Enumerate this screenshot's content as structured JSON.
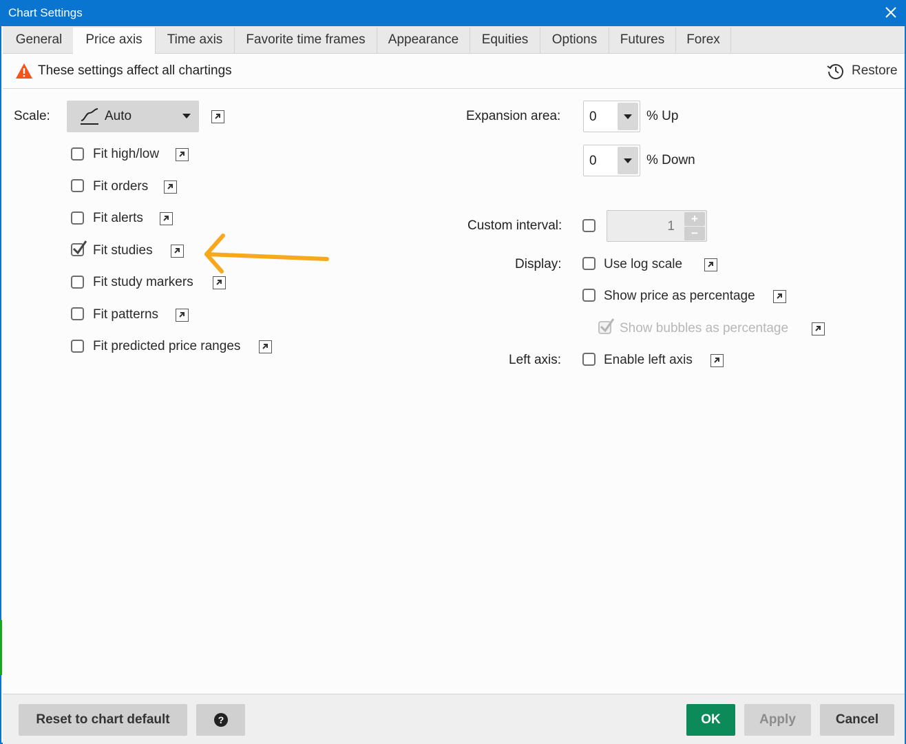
{
  "window": {
    "title": "Chart Settings"
  },
  "tabs": [
    {
      "label": "General"
    },
    {
      "label": "Price axis",
      "active": true
    },
    {
      "label": "Time axis"
    },
    {
      "label": "Favorite time frames"
    },
    {
      "label": "Appearance"
    },
    {
      "label": "Equities"
    },
    {
      "label": "Options"
    },
    {
      "label": "Futures"
    },
    {
      "label": "Forex"
    }
  ],
  "warning": {
    "text": "These settings affect all chartings",
    "icon": "warning-icon"
  },
  "restore": {
    "label": "Restore",
    "icon": "history-icon"
  },
  "scale": {
    "label": "Scale:",
    "value": "Auto"
  },
  "fit_options": [
    {
      "label": "Fit high/low",
      "checked": false
    },
    {
      "label": "Fit orders",
      "checked": false
    },
    {
      "label": "Fit alerts",
      "checked": false
    },
    {
      "label": "Fit studies",
      "checked": true
    },
    {
      "label": "Fit study markers",
      "checked": false
    },
    {
      "label": "Fit patterns",
      "checked": false
    },
    {
      "label": "Fit predicted price ranges",
      "checked": false
    }
  ],
  "expansion": {
    "label": "Expansion area:",
    "up_value": "0",
    "up_unit": "% Up",
    "down_value": "0",
    "down_unit": "% Down"
  },
  "custom_interval": {
    "label": "Custom interval:",
    "checked": false,
    "value": "1"
  },
  "display": {
    "label": "Display:",
    "options": [
      {
        "label": "Use log scale",
        "checked": false,
        "disabled": false
      },
      {
        "label": "Show price as percentage",
        "checked": false,
        "disabled": false
      },
      {
        "label": "Show bubbles as percentage",
        "checked": true,
        "disabled": true
      }
    ]
  },
  "left_axis": {
    "label": "Left axis:",
    "option": "Enable left axis",
    "checked": false
  },
  "footer": {
    "reset_label": "Reset to chart default",
    "help_icon": "help-icon",
    "ok_label": "OK",
    "apply_label": "Apply",
    "cancel_label": "Cancel"
  },
  "colors": {
    "titlebar": "#0a74d1",
    "ok_button": "#0d8a5a",
    "annotation_arrow": "#f7a81b",
    "warning": "#f2541b"
  }
}
